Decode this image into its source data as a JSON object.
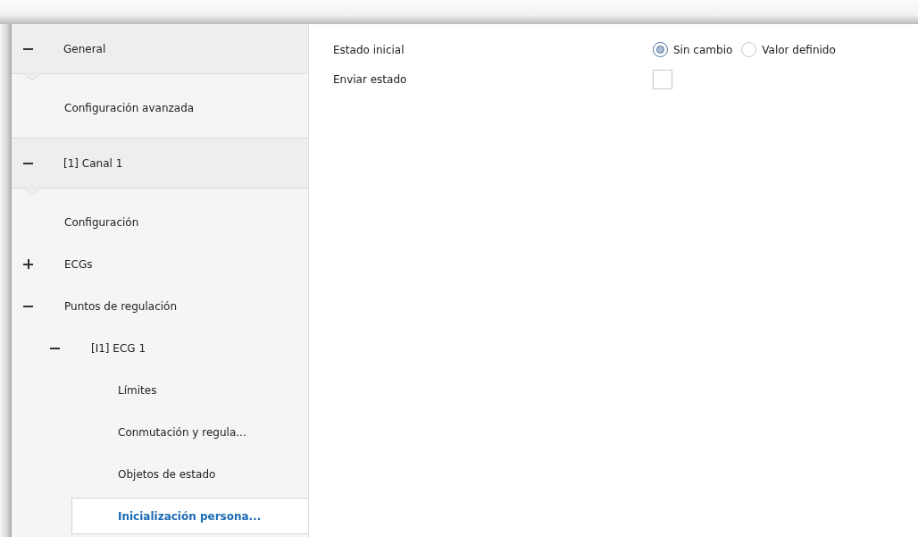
{
  "sidebar": {
    "sections": [
      {
        "label": "General",
        "expanded": true,
        "items": [
          {
            "label": "Configuración avanzada",
            "selected": false
          }
        ]
      },
      {
        "label": "[1] Canal 1",
        "expanded": true,
        "items": [
          {
            "label": "Configuración",
            "selected": false
          },
          {
            "label": "ECGs",
            "selected": false,
            "expanded": false
          },
          {
            "label": "Puntos de regulación",
            "selected": false,
            "expanded": true,
            "children": [
              {
                "label": "[I1] ECG 1",
                "selected": false,
                "expanded": true,
                "children": [
                  {
                    "label": "Límites",
                    "selected": false
                  },
                  {
                    "label": "Conmutación y regula...",
                    "selected": false
                  },
                  {
                    "label": "Objetos de estado",
                    "selected": false
                  },
                  {
                    "label": "Inicialización persona...",
                    "selected": true
                  }
                ]
              }
            ]
          }
        ]
      }
    ]
  },
  "parameters": [
    {
      "kind": "radio",
      "label": "Estado inicial",
      "options": [
        {
          "label": "Sin cambio",
          "selected": true
        },
        {
          "label": "Valor definido",
          "selected": false
        }
      ]
    },
    {
      "kind": "checkbox",
      "label": "Enviar estado",
      "checked": false
    }
  ]
}
